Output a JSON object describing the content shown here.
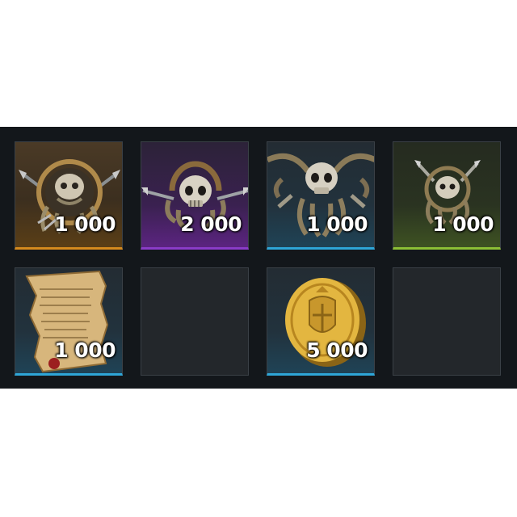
{
  "inventory": {
    "slots": [
      {
        "item_icon": "kraken-medallion-icon",
        "rarity_color": "#d58a1e",
        "quantity": "1 000"
      },
      {
        "item_icon": "kraken-skull-emblem-icon",
        "rarity_color": "#8a3cc8",
        "quantity": "2 000"
      },
      {
        "item_icon": "skull-tentacles-icon",
        "rarity_color": "#2ea6d8",
        "quantity": "1 000"
      },
      {
        "item_icon": "kraken-skull-small-icon",
        "rarity_color": "#8cbf35",
        "quantity": "1 000"
      },
      {
        "item_icon": "parchment-scroll-icon",
        "rarity_color": "#2ea6d8",
        "quantity": "1 000"
      },
      {
        "item_icon": "",
        "rarity_color": "",
        "quantity": ""
      },
      {
        "item_icon": "gold-coin-icon",
        "rarity_color": "#2ea6d8",
        "quantity": "5 000"
      },
      {
        "item_icon": "",
        "rarity_color": "",
        "quantity": ""
      }
    ]
  }
}
